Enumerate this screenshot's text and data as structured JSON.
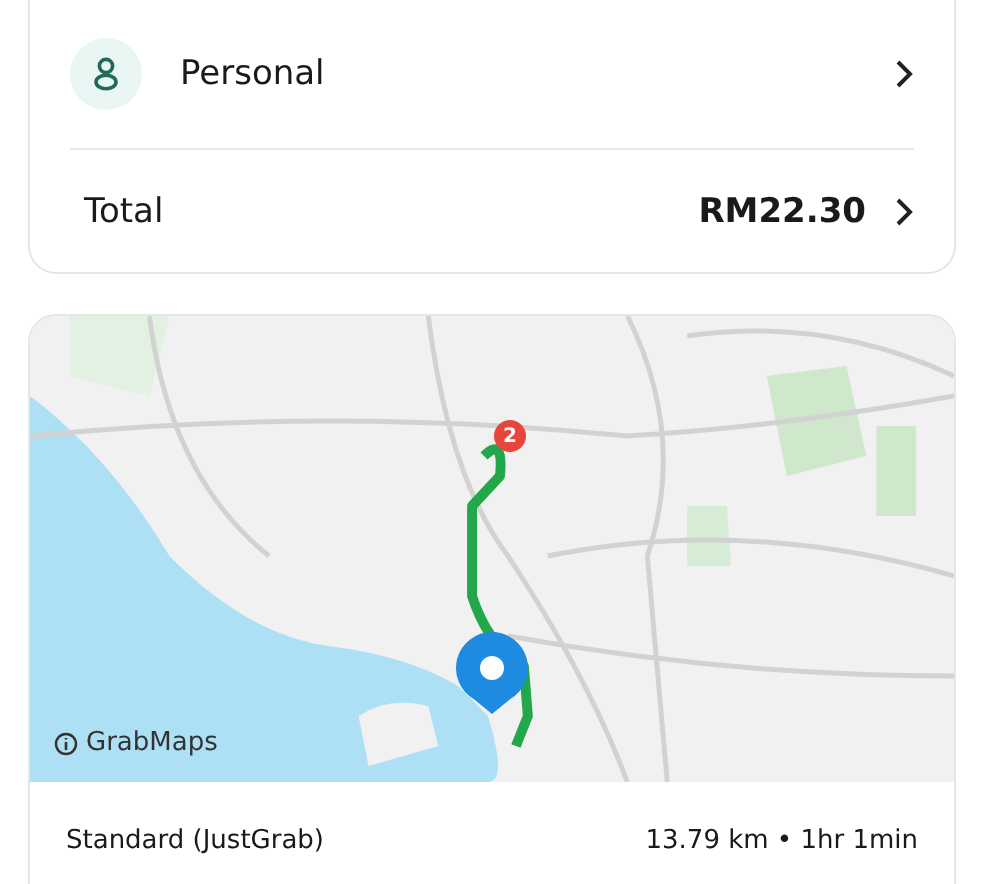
{
  "payment": {
    "label": "Personal"
  },
  "total": {
    "label": "Total",
    "amount": "RM22.30"
  },
  "map": {
    "kind": "picture",
    "stop_badge": "2",
    "attribution": "GrabMaps"
  },
  "trip": {
    "service": "Standard (JustGrab)",
    "summary": "13.79 km • 1hr 1min"
  }
}
